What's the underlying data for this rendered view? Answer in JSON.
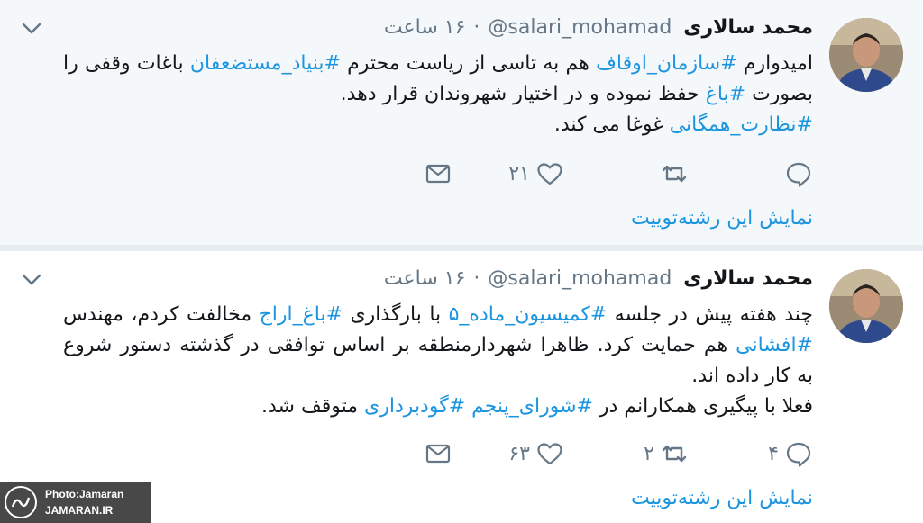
{
  "tweets": [
    {
      "author_name": "محمد سالاری",
      "handle": "@salari_mohamad",
      "time": "۱۶ ساعت",
      "dot": "·",
      "body": [
        {
          "t": "امیدوارم "
        },
        {
          "t": "#سازمان_اوقاف",
          "tag": true
        },
        {
          "t": " هم به تاسی از ریاست محترم "
        },
        {
          "t": "#بنیاد_مستضعفان",
          "tag": true
        },
        {
          "t": " باغات وقفی را بصورت "
        },
        {
          "t": "#باغ",
          "tag": true
        },
        {
          "t": " حفظ نموده و در اختیار شهروندان قرار دهد. "
        },
        {
          "br": true
        },
        {
          "t": "#نظارت_همگانی",
          "tag": true
        },
        {
          "t": " غوغا می کند."
        }
      ],
      "reply_count": "",
      "retweet_count": "",
      "like_count": "۲۱",
      "show_thread": "نمایش این رشته‌توییت"
    },
    {
      "author_name": "محمد سالاری",
      "handle": "@salari_mohamad",
      "time": "۱۶ ساعت",
      "dot": "·",
      "body": [
        {
          "t": "چند هفته پیش در جلسه "
        },
        {
          "t": "#کمیسیون_ماده_۵",
          "tag": true
        },
        {
          "t": " با بارگذاری "
        },
        {
          "t": "#باغ_اراج",
          "tag": true
        },
        {
          "t": " مخالفت کردم، مهندس "
        },
        {
          "t": "#افشانی",
          "tag": true
        },
        {
          "t": " هم حمایت کرد. ظاهرا شهردارمنطقه بر اساس توافقی در گذشته دستور شروع به کار داده اند."
        },
        {
          "br": true
        },
        {
          "t": "فعلا با پیگیری همکارانم در "
        },
        {
          "t": "#شورای_پنجم",
          "tag": true
        },
        {
          "t": " "
        },
        {
          "t": "#گودبرداری",
          "tag": true
        },
        {
          "t": " متوقف شد."
        }
      ],
      "reply_count": "۴",
      "retweet_count": "۲",
      "like_count": "۶۳",
      "show_thread": "نمایش این رشته‌توییت"
    }
  ],
  "watermark": {
    "line1": "Photo:Jamaran",
    "line2": "JAMARAN.IR"
  },
  "icons": {
    "reply": "reply-icon",
    "retweet": "retweet-icon",
    "like": "heart-icon",
    "dm": "envelope-icon",
    "more": "chevron-down-icon"
  },
  "colors": {
    "link": "#1b95e0",
    "muted": "#657786",
    "text": "#14171a"
  }
}
